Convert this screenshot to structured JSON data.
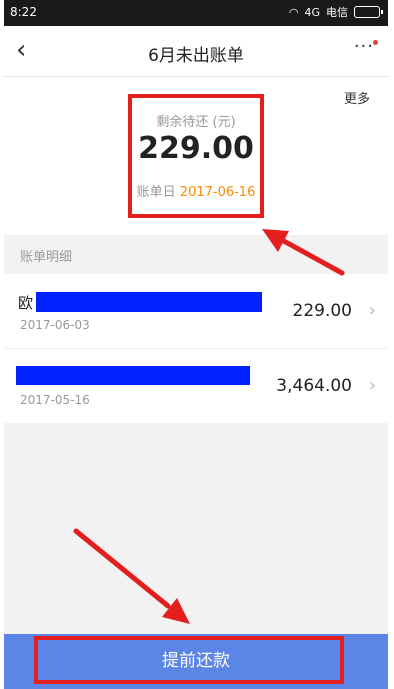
{
  "status_bar": {
    "time": "8:22",
    "carrier": "电信",
    "network": "4G"
  },
  "header": {
    "back_label": "‹",
    "title": "6月未出账单",
    "more_dots": "···"
  },
  "summary": {
    "more_link": "更多",
    "remaining_label": "剩余待还 (元)",
    "remaining_amount": "229.00",
    "due_label": "账单日",
    "due_date": "2017-06-16"
  },
  "details": {
    "section_label": "账单明细",
    "items": [
      {
        "name": "欧",
        "date": "2017-06-03",
        "amount": "229.00"
      },
      {
        "name": "",
        "date": "2017-05-16",
        "amount": "3,464.00"
      }
    ]
  },
  "footer": {
    "repay_button": "提前还款"
  },
  "colors": {
    "accent_button": "#5b86e5",
    "annotation_red": "#e21e1e",
    "due_date_orange": "#ff8a00",
    "redaction_blue": "#0022ff"
  }
}
